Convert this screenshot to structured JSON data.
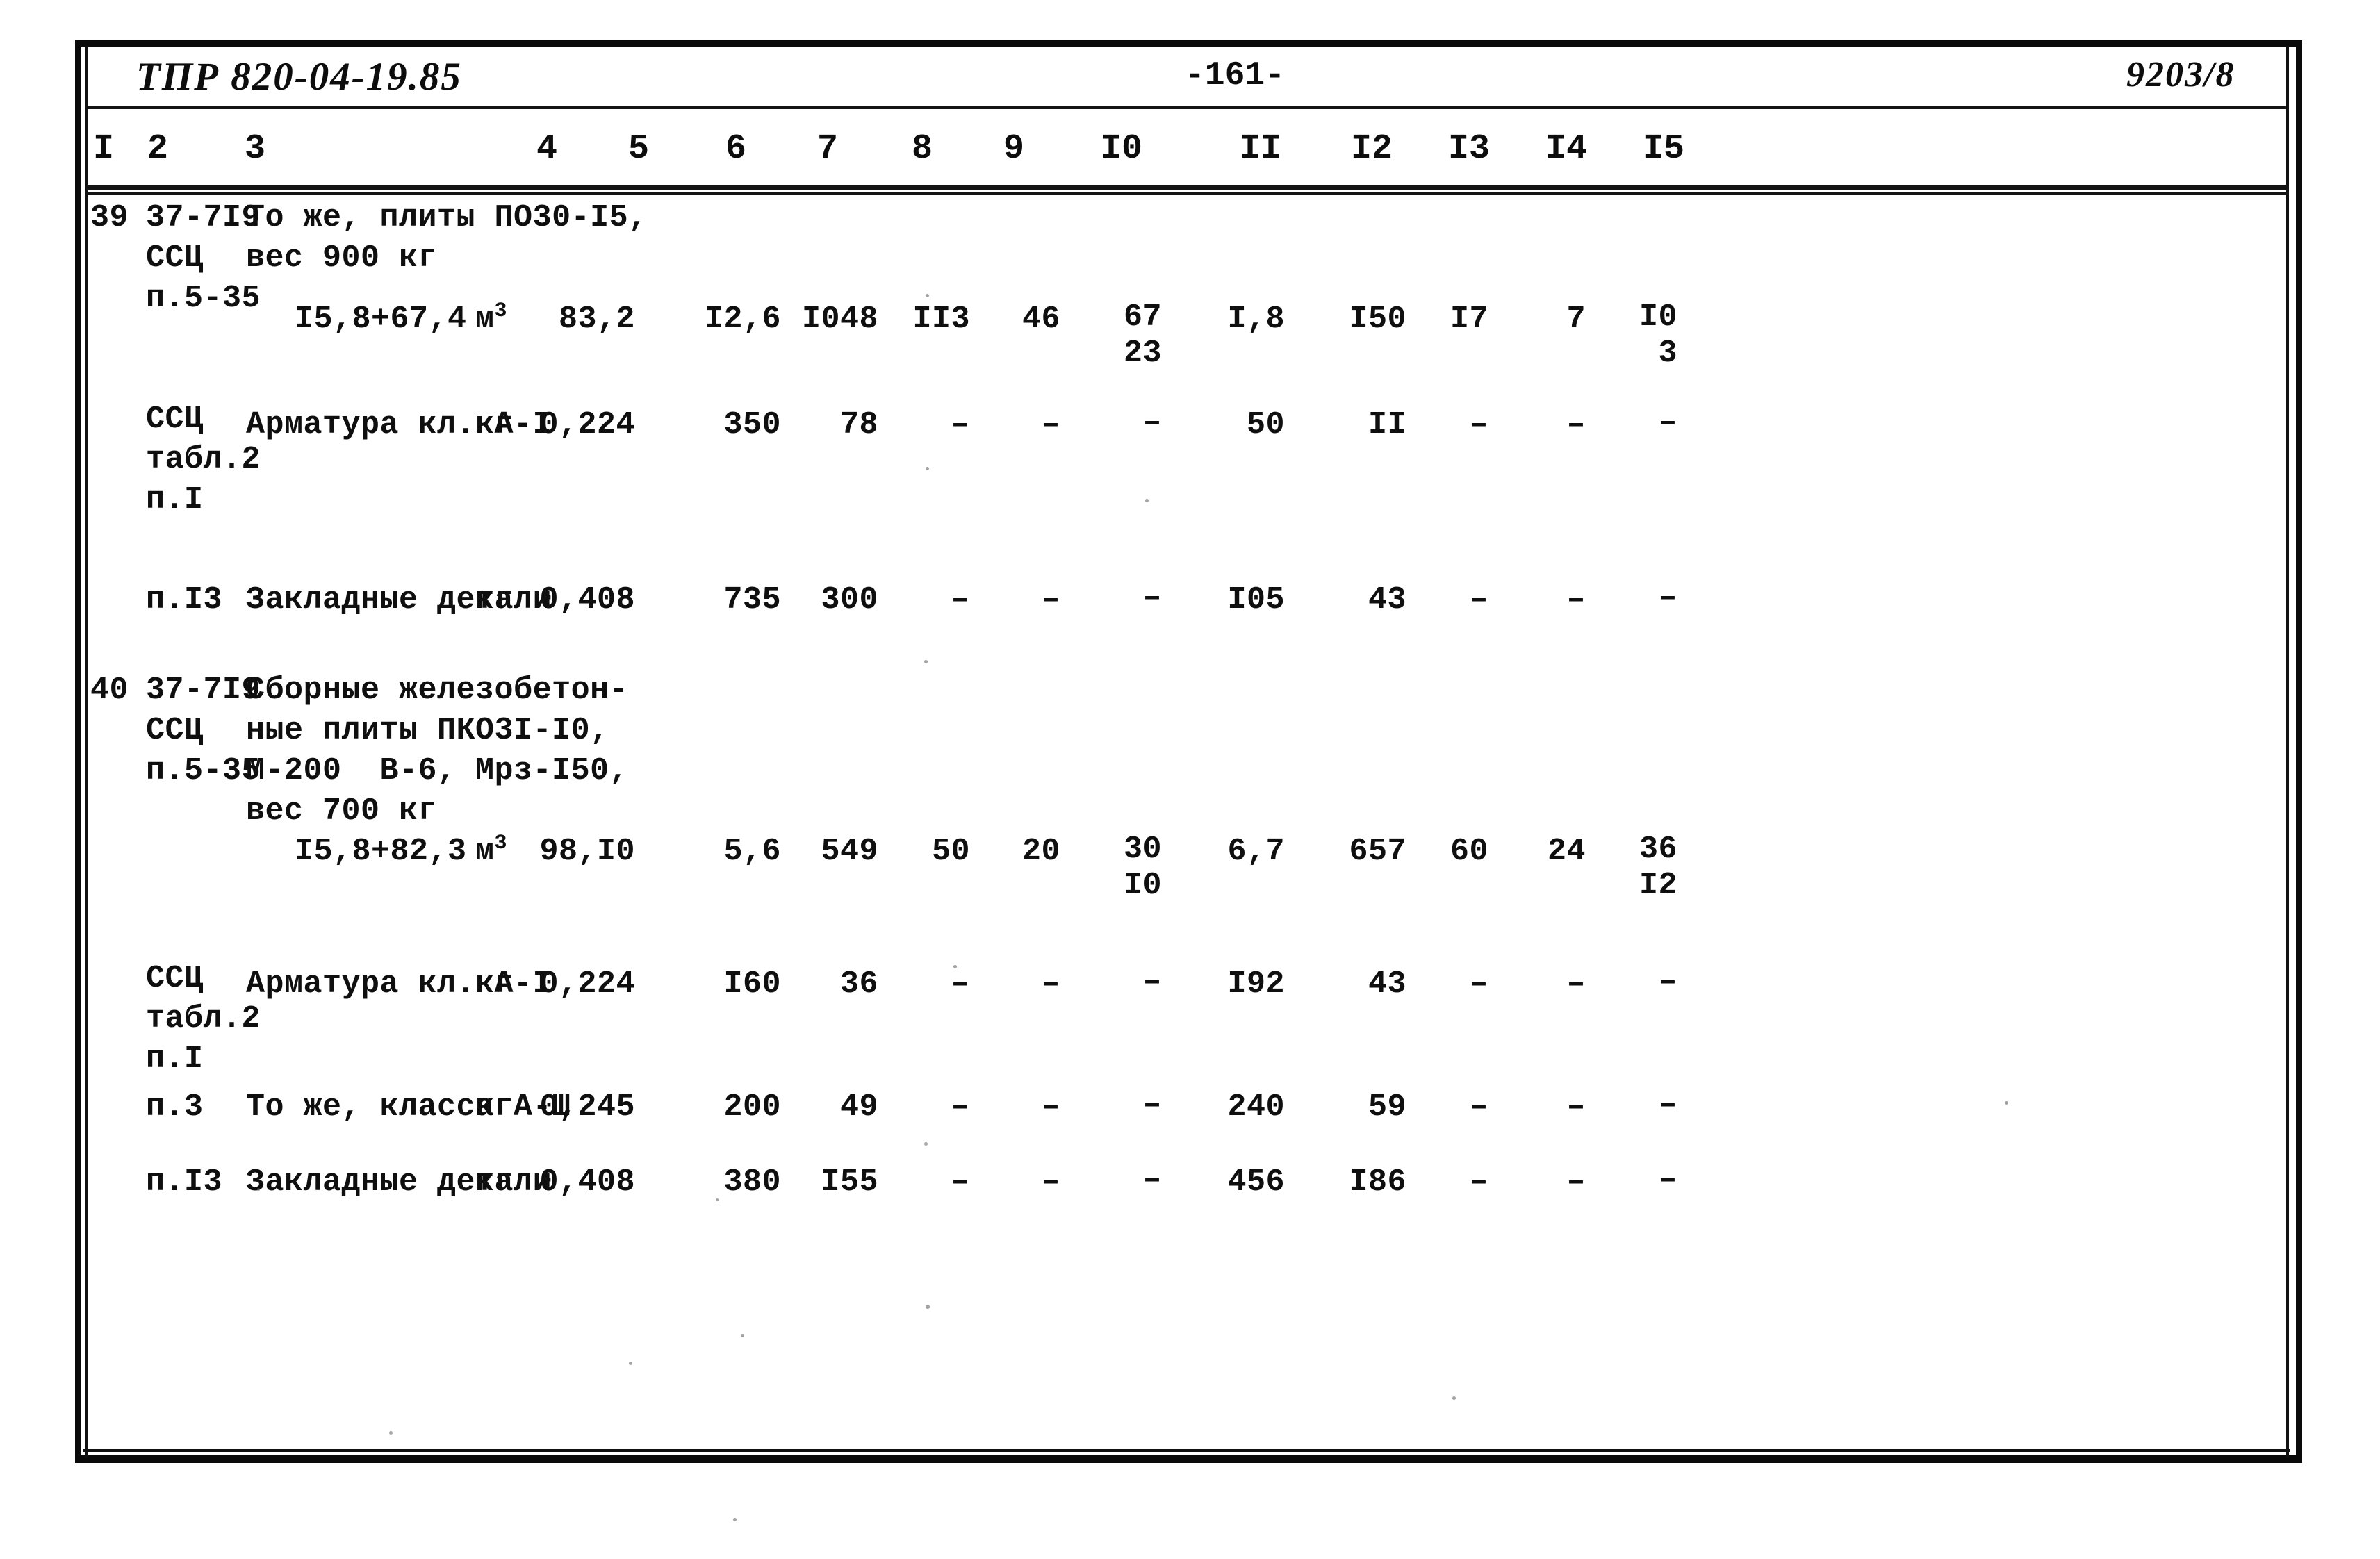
{
  "document": {
    "code": "ТПР 820-04-19.85",
    "page_number": "-161-",
    "stamp": "9203/8"
  },
  "table": {
    "column_numbers": [
      "I",
      "2",
      "3",
      "4",
      "5",
      "6",
      "7",
      "8",
      "9",
      "I0",
      "II",
      "I2",
      "I3",
      "I4",
      "I5"
    ],
    "rows": [
      {
        "c1": "39",
        "c2": "37-7I9\nССЦ\nп.5-35",
        "c3": "То же, плиты ПО30-I5,\nвес 900 кг",
        "c3b": "I5,8+67,4",
        "c4": "м",
        "c4_sup": "3",
        "c5": "83,2",
        "c6": "I2,6",
        "c7": "I048",
        "c8": "II3",
        "c9": "46",
        "c10": "67",
        "c10b": "23",
        "c11": "I,8",
        "c12": "I50",
        "c13": "I7",
        "c14": "7",
        "c15": "I0",
        "c15b": "3"
      },
      {
        "c1": "",
        "c2": "ССЦ\nтабл.2\nп.I",
        "c3": "Арматура кл. А-I",
        "c3b": "",
        "c4": "кг",
        "c4_sup": "",
        "c5": "0,224",
        "c6": "350",
        "c7": "78",
        "c8": "–",
        "c9": "–",
        "c10": "–",
        "c10b": "",
        "c11": "50",
        "c12": "II",
        "c13": "–",
        "c14": "–",
        "c15": "–",
        "c15b": ""
      },
      {
        "c1": "",
        "c2": "п.I3",
        "c3": "Закладные детали",
        "c3b": "",
        "c4": "кг",
        "c4_sup": "",
        "c5": "0,408",
        "c6": "735",
        "c7": "300",
        "c8": "–",
        "c9": "–",
        "c10": "–",
        "c10b": "",
        "c11": "I05",
        "c12": "43",
        "c13": "–",
        "c14": "–",
        "c15": "–",
        "c15b": ""
      },
      {
        "c1": "40",
        "c2": "37-7I9\nССЦ\nп.5-35",
        "c3": "Сборные железобетон-\nные плиты ПКО3I-I0,\nМ-200  В-6, Мрз-I50,\nвес 700 кг",
        "c3b": "I5,8+82,3",
        "c4": "м",
        "c4_sup": "3",
        "c5": "98,I0",
        "c6": "5,6",
        "c7": "549",
        "c8": "50",
        "c9": "20",
        "c10": "30",
        "c10b": "I0",
        "c11": "6,7",
        "c12": "657",
        "c13": "60",
        "c14": "24",
        "c15": "36",
        "c15b": "I2"
      },
      {
        "c1": "",
        "c2": "ССЦ\nтабл.2\nп.I",
        "c3": "Арматура кл. А-I",
        "c3b": "",
        "c4": "кг",
        "c4_sup": "",
        "c5": "0,224",
        "c6": "I60",
        "c7": "36",
        "c8": "–",
        "c9": "–",
        "c10": "–",
        "c10b": "",
        "c11": "I92",
        "c12": "43",
        "c13": "–",
        "c14": "–",
        "c15": "–",
        "c15b": ""
      },
      {
        "c1": "",
        "c2": "п.3",
        "c3": "То же, класса А-Ш",
        "c3b": "",
        "c4": "кг",
        "c4_sup": "",
        "c5": "0,245",
        "c6": "200",
        "c7": "49",
        "c8": "–",
        "c9": "–",
        "c10": "–",
        "c10b": "",
        "c11": "240",
        "c12": "59",
        "c13": "–",
        "c14": "–",
        "c15": "–",
        "c15b": ""
      },
      {
        "c1": "",
        "c2": "п.I3",
        "c3": "Закладные детали",
        "c3b": "",
        "c4": "кг",
        "c4_sup": "",
        "c5": "0,408",
        "c6": "380",
        "c7": "I55",
        "c8": "–",
        "c9": "–",
        "c10": "–",
        "c10b": "",
        "c11": "456",
        "c12": "I86",
        "c13": "–",
        "c14": "–",
        "c15": "–",
        "c15b": ""
      }
    ]
  }
}
